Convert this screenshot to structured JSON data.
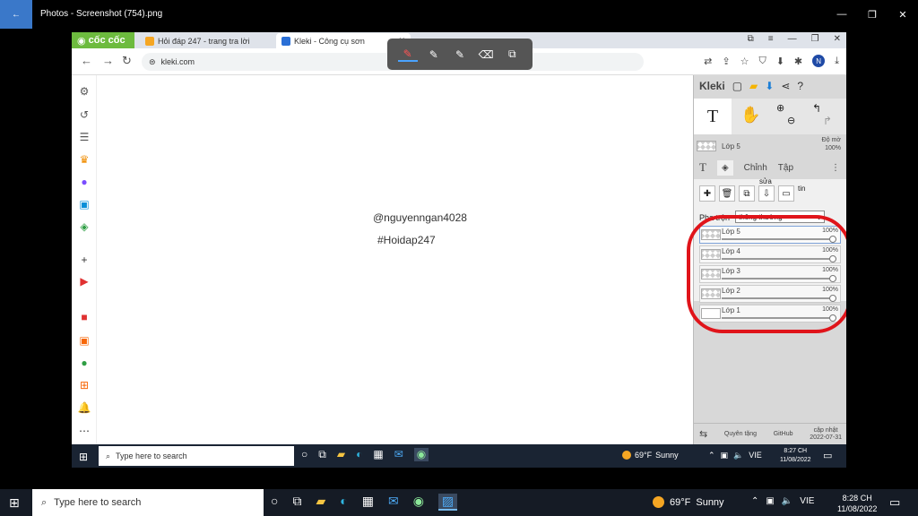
{
  "photos": {
    "title": "Photos - Screenshot (754).png",
    "back_icon": "←",
    "minimize": "—",
    "restore": "❐",
    "close": "✕"
  },
  "browser": {
    "brand": "cốc cốc",
    "tabs": [
      {
        "label": "Hỏi đáp 247 - trang tra lời",
        "fav_color": "#f5a623",
        "close": ""
      },
      {
        "label": "Kleki - Công cụ sơn",
        "fav_color": "#2a6fd6",
        "close": "✕"
      }
    ],
    "new_tab": "+",
    "url": "kleki.com",
    "avatar_letter": "N"
  },
  "pen_tools": [
    "✎",
    "✎",
    "✎",
    "⌫",
    "⧉"
  ],
  "canvas": {
    "text1": "@nguyenngan4028",
    "text2": "#Hoidap247"
  },
  "kleki": {
    "logo": "Kleki",
    "tool_text": "T",
    "current_layer": "Lớp 5",
    "opacity_label": "Độ mờ",
    "opacity_value": "100%",
    "tab_text_icon": "T",
    "tab_edit": "Chỉnh",
    "tab_file": "Tập",
    "tab_more": "⋮",
    "btn_merge_label": "sửa",
    "btn_info_label": "tin",
    "blend_label": "Pha trộn",
    "blend_value": "thông thường",
    "layers": [
      {
        "name": "Lớp 5",
        "pct": "100%"
      },
      {
        "name": "Lớp 4",
        "pct": "100%"
      },
      {
        "name": "Lớp 3",
        "pct": "100%"
      },
      {
        "name": "Lớp 2",
        "pct": "100%"
      },
      {
        "name": "Lớp 1",
        "pct": "100%"
      }
    ],
    "footer_donate": "Quyên tặng",
    "footer_github": "GitHub",
    "footer_update": "cập nhật",
    "footer_date": "2022-07-31"
  },
  "inner_taskbar": {
    "search_placeholder": "Type here to search",
    "temp": "69°F",
    "weather": "Sunny",
    "lang": "VIE",
    "time": "8:27 CH",
    "date": "11/08/2022"
  },
  "outer_taskbar": {
    "search_placeholder": "Type here to search",
    "temp": "69°F",
    "weather": "Sunny",
    "lang": "VIE",
    "time": "8:28 CH",
    "date": "11/08/2022"
  }
}
